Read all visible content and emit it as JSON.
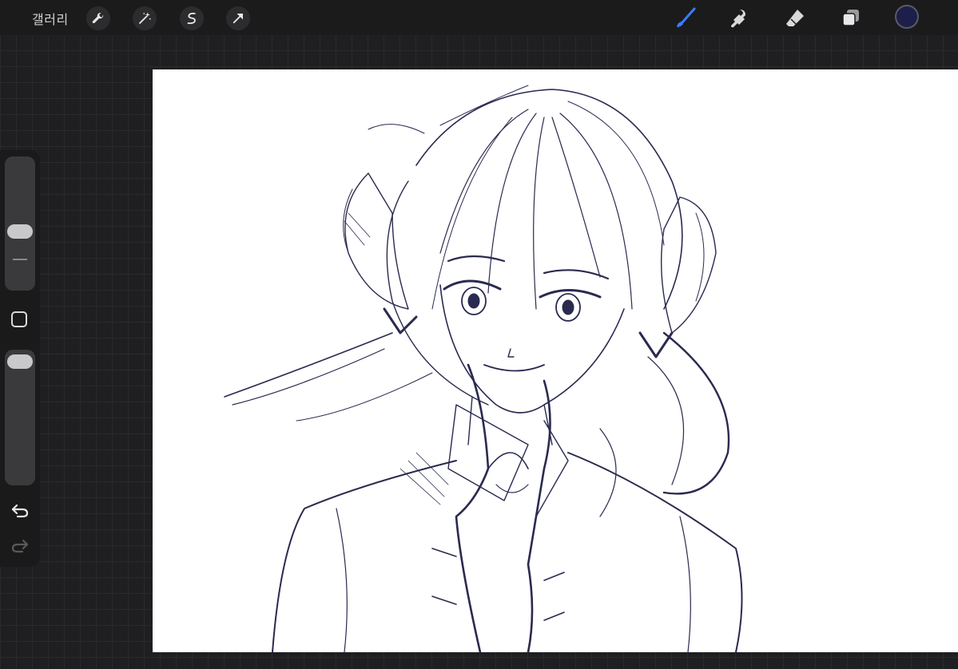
{
  "app": {
    "gallery_label": "갤러리"
  },
  "toolbar": {
    "left_tools": [
      "wrench-icon",
      "magic-wand-icon",
      "selection-icon",
      "transform-icon"
    ],
    "right_tools": [
      "brush-icon",
      "smudge-icon",
      "eraser-icon",
      "layers-icon"
    ],
    "active_tool": "brush-icon",
    "current_color": "#1e1e4a",
    "accent_color": "#3d7bff"
  },
  "sidebar": {
    "brush_size_level": 0.45,
    "opacity_level": 1.0
  },
  "canvas": {
    "background": "#ffffff",
    "ink_color": "#2a2a50"
  }
}
